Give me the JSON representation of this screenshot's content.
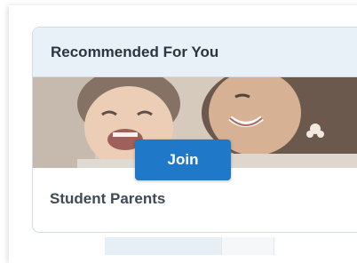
{
  "card": {
    "title": "Recommended For You",
    "join_label": "Join",
    "group_name": "Student Parents"
  },
  "colors": {
    "header_bg": "#e8f0f8",
    "accent": "#1f78c8",
    "title_text": "#2b3440"
  }
}
